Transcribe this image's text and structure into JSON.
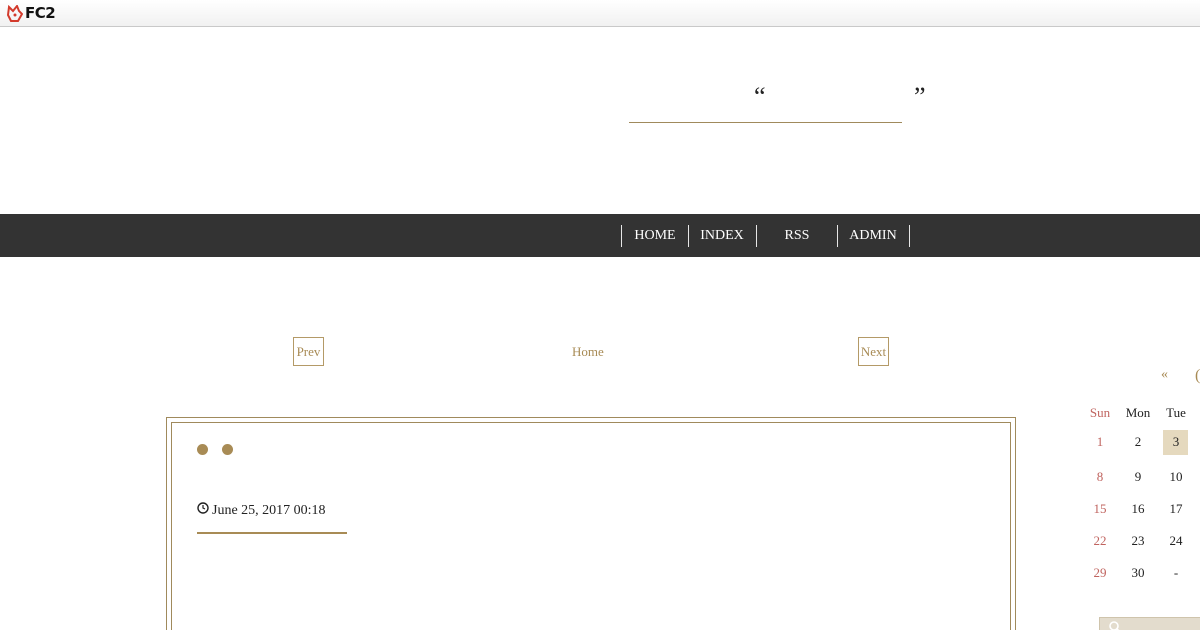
{
  "topbar": {
    "logo_text": "FC2",
    "logo_color": "#d33a2c"
  },
  "header": {
    "quote_open": "“",
    "quote_close": "”",
    "blog_title": ""
  },
  "nav": {
    "items": [
      {
        "label": "HOME"
      },
      {
        "label": "INDEX"
      },
      {
        "label": "RSS"
      },
      {
        "label": "ADMIN"
      }
    ],
    "background": "#333333"
  },
  "pager": {
    "prev_label": "Prev",
    "home_label": "Home",
    "next_label": "Next",
    "accent": "#a88b55"
  },
  "article": {
    "date": "June 25, 2017 00:18"
  },
  "calendar": {
    "prev_symbol": "«",
    "headers": [
      "Sun",
      "Mon",
      "Tue"
    ],
    "rows": [
      [
        "1",
        "2",
        "3"
      ],
      [
        "8",
        "9",
        "10"
      ],
      [
        "15",
        "16",
        "17"
      ],
      [
        "22",
        "23",
        "24"
      ],
      [
        "29",
        "30",
        "-"
      ]
    ],
    "today": "3",
    "sunday_color": "#c0645f",
    "today_bg": "#e5d9be"
  }
}
